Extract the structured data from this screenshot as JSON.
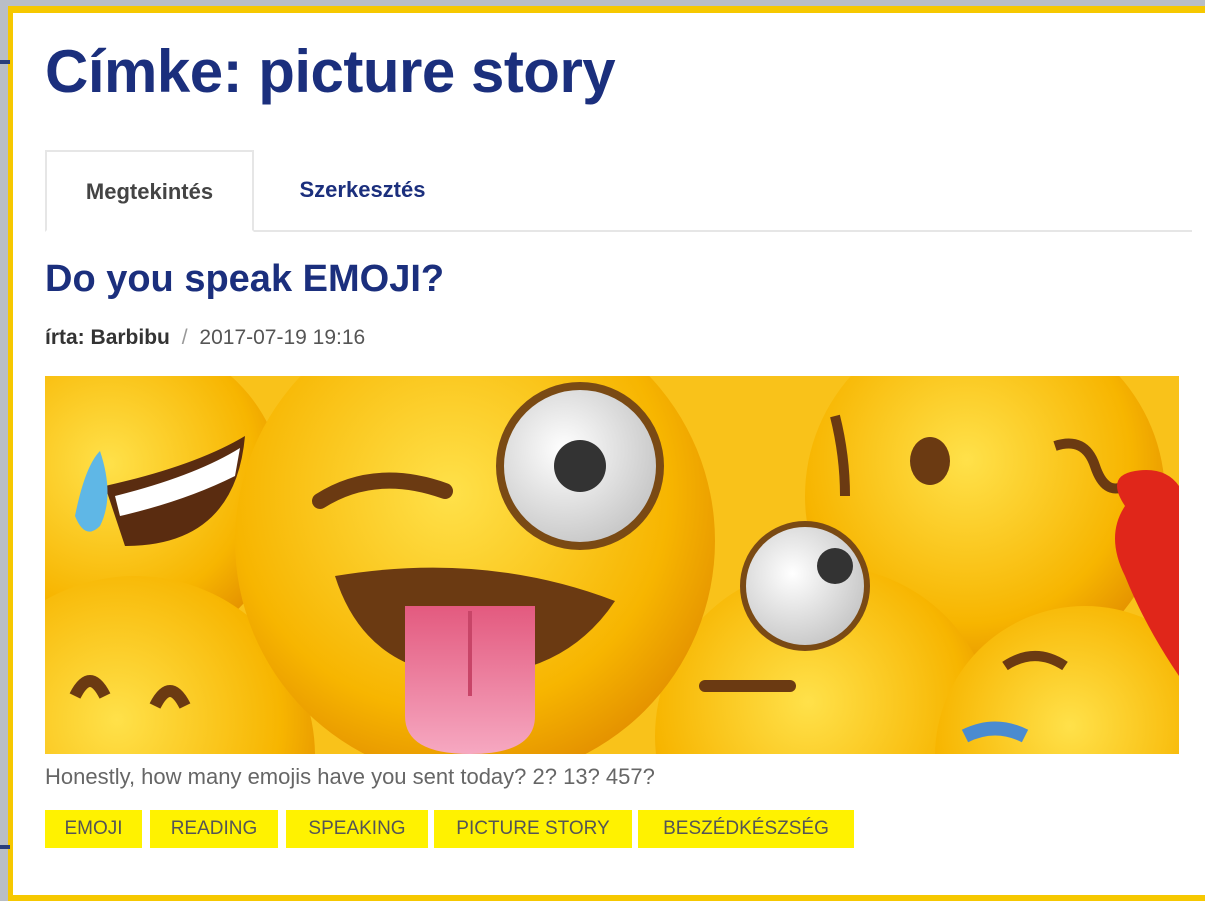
{
  "page": {
    "title": "Címke: picture story"
  },
  "tabs": [
    {
      "label": "Megtekintés",
      "active": true
    },
    {
      "label": "Szerkesztés",
      "active": false
    }
  ],
  "article": {
    "title": "Do you speak EMOJI?",
    "author_prefix": "írta:",
    "author": "Barbibu",
    "separator": "/",
    "date": "2017-07-19 19:16",
    "image_icon": "emoji-collage-image",
    "teaser": "Honestly, how many emojis have you sent today? 2? 13? 457?",
    "tags": [
      "EMOJI",
      "READING",
      "SPEAKING",
      "PICTURE STORY",
      "BESZÉDKÉSZSÉG"
    ]
  },
  "colors": {
    "frame": "#f6c800",
    "title": "#1b2f7d",
    "tag_bg": "#fff200",
    "emoji": "#f7b500"
  }
}
